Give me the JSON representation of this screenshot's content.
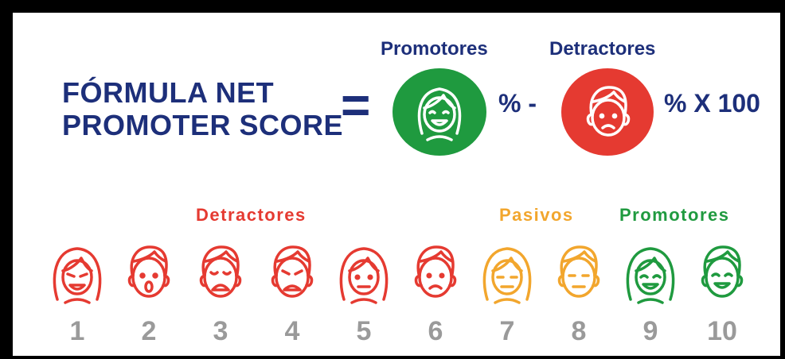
{
  "title": {
    "line1": "FÓRMULA NET",
    "line2": "PROMOTER SCORE"
  },
  "formula": {
    "equals": "=",
    "promoters_label": "Promotores",
    "detractors_label": "Detractores",
    "percent_minus": "% -",
    "percent_times": "% X 100"
  },
  "scale": {
    "groups": {
      "detractors": "Detractores",
      "passives": "Pasivos",
      "promoters": "Promotores"
    },
    "numbers": [
      "1",
      "2",
      "3",
      "4",
      "5",
      "6",
      "7",
      "8",
      "9",
      "10"
    ]
  },
  "colors": {
    "navy": "#1d2f7a",
    "red": "#e53a31",
    "orange": "#f2a62d",
    "green": "#1f9a3f",
    "grey": "#9a9a9a"
  }
}
